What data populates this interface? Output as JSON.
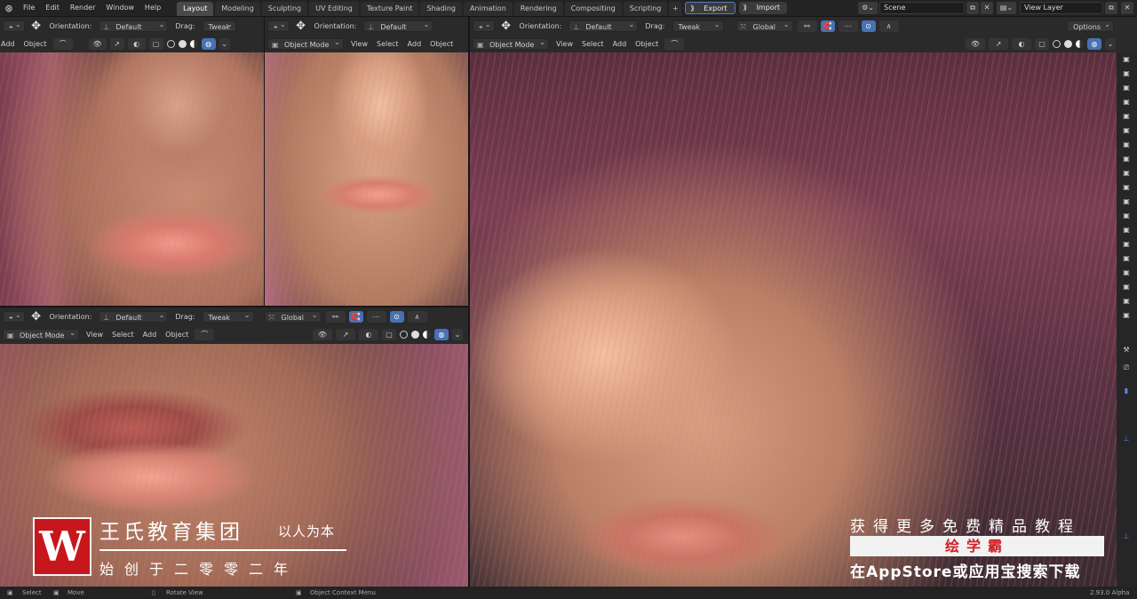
{
  "menu": [
    "File",
    "Edit",
    "Render",
    "Window",
    "Help"
  ],
  "tabs": [
    {
      "label": "Layout",
      "active": true
    },
    {
      "label": "Modeling"
    },
    {
      "label": "Sculpting"
    },
    {
      "label": "UV Editing"
    },
    {
      "label": "Texture Paint"
    },
    {
      "label": "Shading"
    },
    {
      "label": "Animation"
    },
    {
      "label": "Rendering"
    },
    {
      "label": "Compositing"
    },
    {
      "label": "Scripting"
    }
  ],
  "top_buttons": {
    "export": "Export",
    "import": "Import"
  },
  "scene": {
    "value": "Scene"
  },
  "view_layer": {
    "value": "View Layer"
  },
  "tool_header": {
    "orientation_label": "Orientation:",
    "orientation_value": "Default",
    "drag_label": "Drag:",
    "drag_value": "Tweak",
    "transform_value": "Global",
    "options": "Options"
  },
  "view_header": {
    "mode": "Object Mode",
    "view": "View",
    "select": "Select",
    "add": "Add",
    "object": "Object"
  },
  "status_bar": {
    "select": "Select",
    "move": "Move",
    "rotate": "Rotate View",
    "context": "Object Context Menu",
    "version": "2.93.0 Alpha"
  },
  "watermark": {
    "logo_letter": "W",
    "title": "王氏教育集团",
    "subtitle": "以人为本",
    "year": "始创于二零零二年",
    "promo": "获得更多免费精品教程",
    "app_name": "绘学霸",
    "download": "在AppStore或应用宝搜索下载"
  },
  "colors": {
    "accent": "#4772b3",
    "watermark_red": "#c8161d"
  }
}
